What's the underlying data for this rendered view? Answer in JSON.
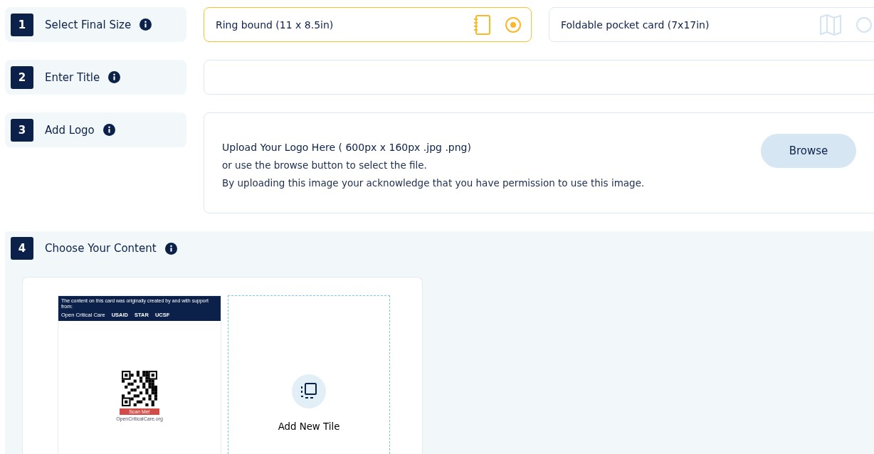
{
  "steps": [
    {
      "number": "1",
      "label": "Select Final Size",
      "kind": "size"
    },
    {
      "number": "2",
      "label": "Enter Title",
      "kind": "title"
    },
    {
      "number": "3",
      "label": "Add Logo",
      "kind": "logo"
    },
    {
      "number": "4",
      "label": "Choose Your Content",
      "kind": "content"
    }
  ],
  "size_options": [
    {
      "label": "Ring bound (11 x 8.5in)",
      "selected": true
    },
    {
      "label": "Foldable pocket card (7x17in)",
      "selected": false
    }
  ],
  "logo_upload": {
    "heading": "Upload Your Logo Here ( 600px x 160px .jpg .png)",
    "lines": [
      "or use the browse button to select the file.",
      "By uploading this image your acknowledge that you have permission to use this image."
    ],
    "button": "Browse"
  },
  "tiles": [
    {
      "kind": "card",
      "header": "The content on this card was originally created by and with support from:",
      "logos": [
        "Open Critical Care",
        "USAID",
        "STAR",
        "UCSF"
      ],
      "scan_label": "Scan Me!",
      "footer": "OpenCriticalCare.org"
    },
    {
      "kind": "add",
      "label": "Add New Tile"
    }
  ]
}
